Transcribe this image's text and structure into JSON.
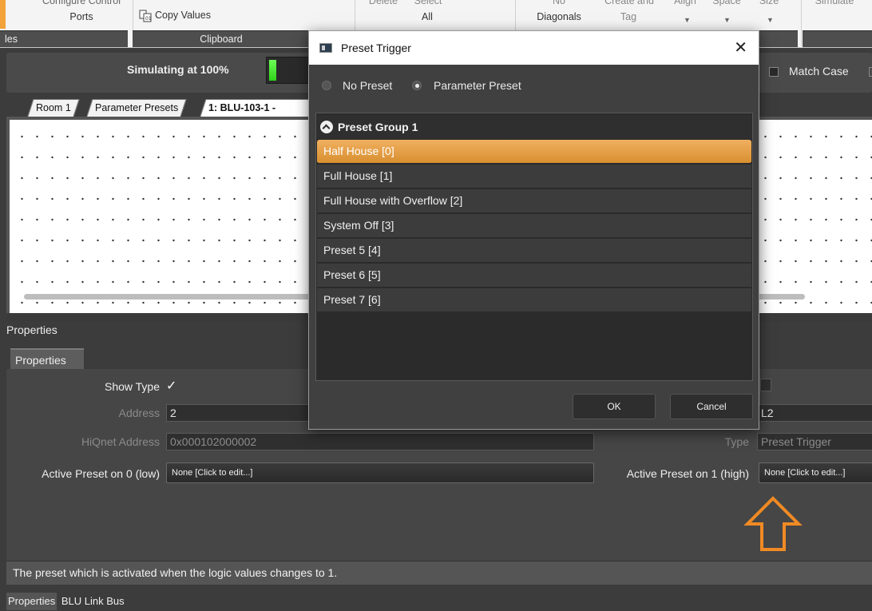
{
  "ribbon": {
    "configure_ports": "Ports",
    "configure_top": "Configure Control",
    "copy_values": "Copy Values",
    "delete_top": "Delete",
    "select_top": "Select",
    "select_all": "All",
    "no_top": "No",
    "no_diagonals": "Diagonals",
    "create_top": "Create and",
    "tag": "Tag",
    "align": "Align",
    "space": "Space",
    "size": "Size",
    "simulate": "Simulate",
    "groups": {
      "g1": "les",
      "clipboard": "Clipboard"
    }
  },
  "sim": {
    "status": "Simulating at 100%"
  },
  "tabs": [
    "Room 1",
    "Parameter Presets",
    "1: BLU-103-1 -"
  ],
  "search": {
    "match_case": "Match Case"
  },
  "dialog": {
    "title": "Preset Trigger",
    "close": "✕",
    "radio_none": "No Preset",
    "radio_param": "Parameter Preset",
    "group": "Preset Group 1",
    "items": [
      "Half House [0]",
      "Full House [1]",
      "Full House with Overflow [2]",
      "System Off [3]",
      "Preset 5 [4]",
      "Preset 6 [5]",
      "Preset 7 [6]"
    ],
    "ok": "OK",
    "cancel": "Cancel"
  },
  "properties": {
    "header": "Properties",
    "tab": "Properties",
    "show_type_label": "Show Type",
    "show_type_value": "✓",
    "address_label": "Address",
    "address_value": "2",
    "hiqnet_label": "HiQnet Address",
    "hiqnet_value": "0x000102000002",
    "name_value": "L2",
    "type_label": "Type",
    "type_value": "Preset Trigger",
    "active_low_label": "Active Preset on 0 (low)",
    "active_low_value": "None [Click to edit...]",
    "active_high_label": "Active Preset on 1 (high)",
    "active_high_value": "None [Click to edit...]"
  },
  "status": "The preset which is activated when the logic values changes to 1.",
  "bottom_tabs": [
    "Properties",
    "BLU Link Bus"
  ],
  "colors": {
    "accent": "#f3a23a",
    "selection": "#e39c43",
    "arrow": "#f08a24"
  }
}
